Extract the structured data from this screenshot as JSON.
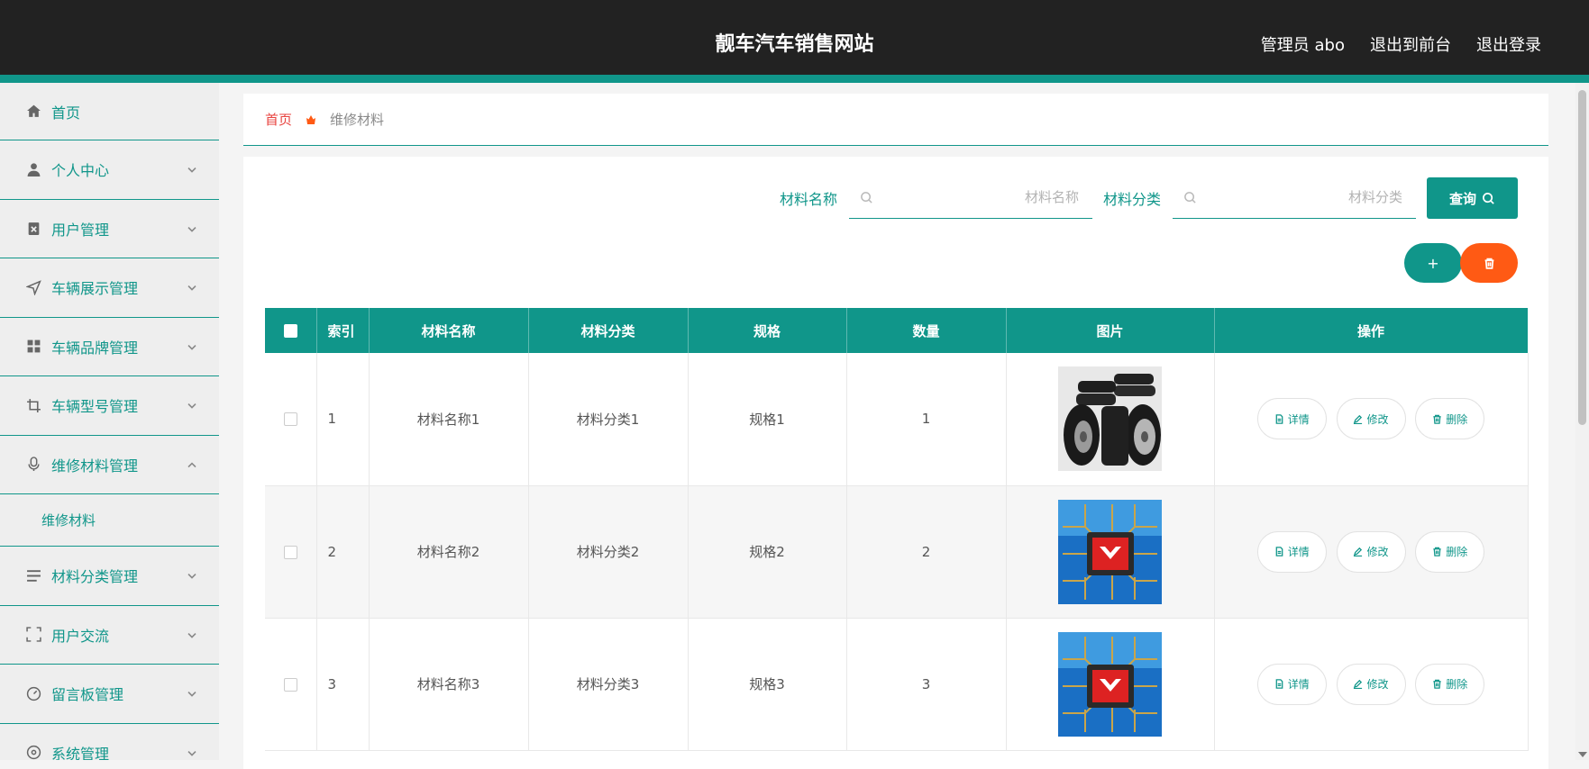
{
  "header": {
    "title": "靓车汽车销售网站",
    "links": [
      "管理员 abo",
      "退出到前台",
      "退出登录"
    ]
  },
  "sidebar": {
    "items": [
      {
        "label": "首页",
        "icon": "home-icon"
      },
      {
        "label": "个人中心",
        "icon": "user-icon"
      },
      {
        "label": "用户管理",
        "icon": "clipboard-x-icon"
      },
      {
        "label": "车辆展示管理",
        "icon": "navigation-arrow-icon"
      },
      {
        "label": "车辆品牌管理",
        "icon": "grid-icon"
      },
      {
        "label": "车辆型号管理",
        "icon": "crop-icon"
      },
      {
        "label": "维修材料管理",
        "icon": "microphone-icon"
      },
      {
        "label": "材料分类管理",
        "icon": "list-icon"
      },
      {
        "label": "用户交流",
        "icon": "fullscreen-icon"
      },
      {
        "label": "留言板管理",
        "icon": "dashboard-icon"
      },
      {
        "label": "系统管理",
        "icon": "settings-icon"
      }
    ],
    "submenu": "维修材料"
  },
  "breadcrumb": {
    "home": "首页",
    "current": "维修材料"
  },
  "search": {
    "name_label": "材料名称",
    "name_placeholder": "材料名称",
    "category_label": "材料分类",
    "category_placeholder": "材料分类",
    "query_label": "查询"
  },
  "actions": {
    "add_label": "+"
  },
  "table": {
    "headers": [
      "索引",
      "材料名称",
      "材料分类",
      "规格",
      "数量",
      "图片",
      "操作"
    ],
    "rows": [
      {
        "index": "1",
        "name": "材料名称1",
        "category": "材料分类1",
        "spec": "规格1",
        "qty": "1",
        "image": "tires-image"
      },
      {
        "index": "2",
        "name": "材料名称2",
        "category": "材料分类2",
        "spec": "规格2",
        "qty": "2",
        "image": "chip-image"
      },
      {
        "index": "3",
        "name": "材料名称3",
        "category": "材料分类3",
        "spec": "规格3",
        "qty": "3",
        "image": "chip-image"
      }
    ],
    "ops": {
      "detail": "详情",
      "edit": "修改",
      "delete": "删除"
    }
  },
  "colors": {
    "accent": "#10968a",
    "danger": "#ff5a14",
    "header_bg": "#222222",
    "breadcrumb_home": "#e8433f"
  }
}
